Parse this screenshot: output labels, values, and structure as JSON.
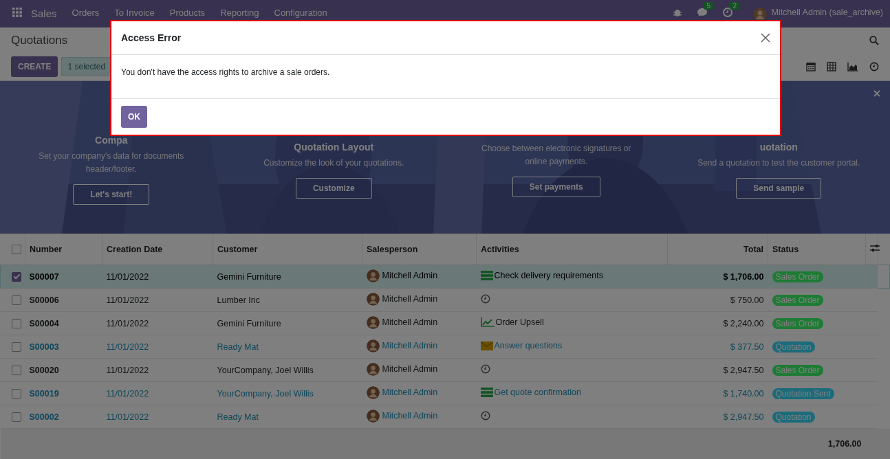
{
  "navbar": {
    "app": "Sales",
    "menu": [
      "Orders",
      "To Invoice",
      "Products",
      "Reporting",
      "Configuration"
    ],
    "messages_badge": "5",
    "activities_badge": "2",
    "user": "Mitchell Admin (sale_archive)"
  },
  "control_panel": {
    "title": "Quotations",
    "create": "CREATE",
    "selection": "1 selected"
  },
  "onboarding": {
    "steps": [
      {
        "title": "Compa",
        "description": "Set your company's data for documents header/footer.",
        "button": "Let's start!"
      },
      {
        "title": "Quotation Layout",
        "description": "Customize the look of your quotations.",
        "button": "Customize"
      },
      {
        "description": "Choose between electronic signatures or online payments.",
        "button": "Set payments"
      },
      {
        "title": "uotation",
        "description": "Send a quotation to test the customer portal.",
        "button": "Send sample"
      }
    ]
  },
  "table": {
    "all_selected": false,
    "columns": [
      "Number",
      "Creation Date",
      "Customer",
      "Salesperson",
      "Activities",
      "Total",
      "Status"
    ],
    "rows": [
      {
        "selected": true,
        "kind": "plain",
        "number": "S00007",
        "date": "11/01/2022",
        "customer": "Gemini Furniture",
        "salesperson": "Mitchell Admin",
        "activity": {
          "kind": "todo",
          "summary": "Check delivery requirements"
        },
        "total": "$ 1,706.00",
        "status": {
          "label": "Sales Order",
          "color": "#1e7b34"
        }
      },
      {
        "selected": false,
        "kind": "plain",
        "number": "S00006",
        "date": "11/01/2022",
        "customer": "Lumber Inc",
        "salesperson": "Mitchell Admin",
        "activity": {
          "kind": "none"
        },
        "total": "$ 750.00",
        "status": {
          "label": "Sales Order",
          "color": "#1e7b34"
        }
      },
      {
        "selected": false,
        "kind": "plain",
        "number": "S00004",
        "date": "11/01/2022",
        "customer": "Gemini Furniture",
        "salesperson": "Mitchell Admin",
        "activity": {
          "kind": "upsell",
          "summary": "Order Upsell"
        },
        "total": "$ 2,240.00",
        "status": {
          "label": "Sales Order",
          "color": "#1e7b34"
        }
      },
      {
        "selected": false,
        "kind": "info",
        "number": "S00003",
        "date": "11/01/2022",
        "customer": "Ready Mat",
        "salesperson": "Mitchell Admin",
        "activity": {
          "kind": "email",
          "summary": "Answer questions"
        },
        "total": "$ 377.50",
        "status": {
          "label": "Quotation",
          "color": "#1b6b7b"
        }
      },
      {
        "selected": false,
        "kind": "plain",
        "number": "S00020",
        "date": "11/01/2022",
        "customer": "YourCompany, Joel Willis",
        "salesperson": "Mitchell Admin",
        "activity": {
          "kind": "none"
        },
        "total": "$ 2,947.50",
        "status": {
          "label": "Sales Order",
          "color": "#1e7b34"
        }
      },
      {
        "selected": false,
        "kind": "info",
        "number": "S00019",
        "date": "11/01/2022",
        "customer": "YourCompany, Joel Willis",
        "salesperson": "Mitchell Admin",
        "activity": {
          "kind": "todo",
          "summary": "Get quote confirmation"
        },
        "total": "$ 1,740.00",
        "status": {
          "label": "Quotation Sent",
          "color": "#1b6b7b"
        }
      },
      {
        "selected": false,
        "kind": "info",
        "number": "S00002",
        "date": "11/01/2022",
        "customer": "Ready Mat",
        "salesperson": "Mitchell Admin",
        "activity": {
          "kind": "none"
        },
        "total": "$ 2,947.50",
        "status": {
          "label": "Quotation",
          "color": "#1b6b7b"
        }
      }
    ],
    "footer_total": "1,706.00"
  },
  "dialog": {
    "title": "Access Error",
    "message": "You don't have the access rights to archive a sale orders.",
    "button": "OK"
  }
}
